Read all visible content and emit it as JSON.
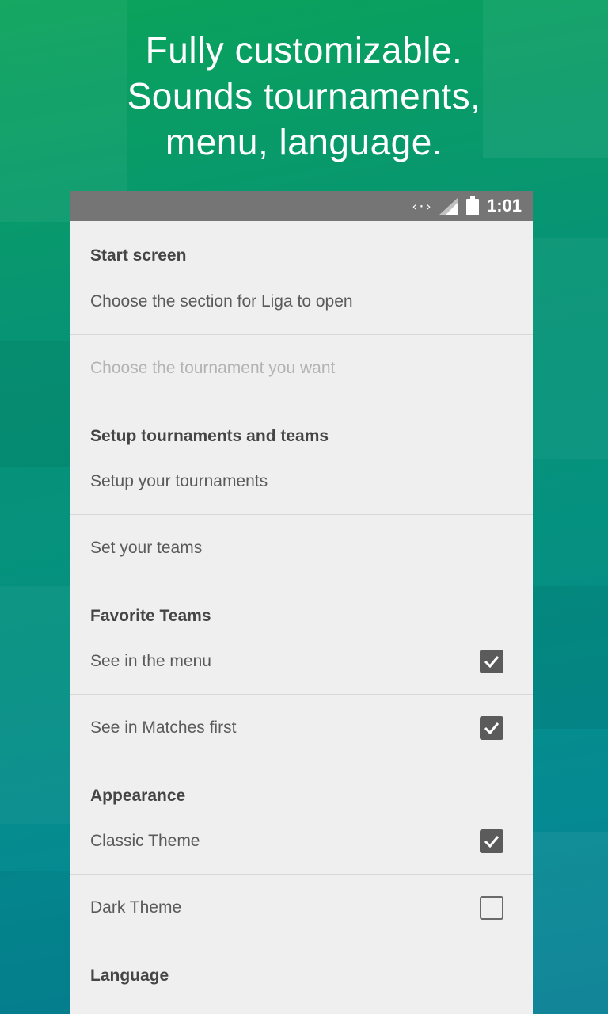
{
  "promo": {
    "headline_lines": [
      "Fully customizable.",
      "Sounds tournaments,",
      "menu, language."
    ]
  },
  "status_bar": {
    "time": "1:01",
    "icons": [
      "data-transfer-icon",
      "signal-icon",
      "battery-icon"
    ]
  },
  "settings": {
    "sections": [
      {
        "header": "Start screen",
        "items": [
          {
            "label": "Choose the section for Liga to open"
          },
          {
            "label": "Choose the tournament you want",
            "disabled": true
          }
        ]
      },
      {
        "header": "Setup tournaments and teams",
        "items": [
          {
            "label": "Setup your tournaments"
          },
          {
            "label": "Set your teams"
          }
        ]
      },
      {
        "header": "Favorite Teams",
        "items": [
          {
            "label": "See in the menu",
            "checked": true
          },
          {
            "label": "See in Matches first",
            "checked": true
          }
        ]
      },
      {
        "header": "Appearance",
        "items": [
          {
            "label": "Classic Theme",
            "checked": true
          },
          {
            "label": "Dark Theme",
            "checked": false
          }
        ]
      },
      {
        "header": "Language",
        "items": []
      }
    ]
  },
  "colors": {
    "status_bar": "#757575",
    "panel_background": "#efefef",
    "checkbox": "#5b5b5b"
  }
}
